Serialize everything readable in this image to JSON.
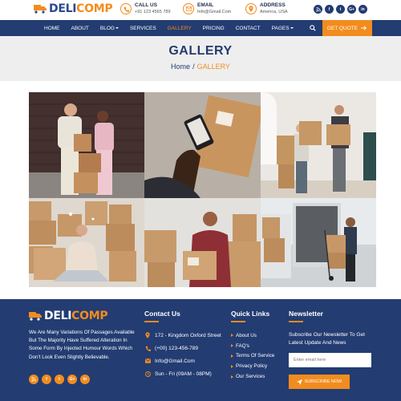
{
  "brand": {
    "part1": "DELI",
    "part2": "COMP"
  },
  "header": {
    "call": {
      "label": "CALL US",
      "value": "+91 123 4565 789"
    },
    "email": {
      "label": "EMAIL",
      "value": "Info@Gmail.Com"
    },
    "address": {
      "label": "ADDRESS",
      "value": "America, USA"
    },
    "socials": [
      "f",
      "t",
      "G+",
      "in"
    ]
  },
  "nav": {
    "items": [
      {
        "label": "HOME"
      },
      {
        "label": "ABOUT"
      },
      {
        "label": "BLOG"
      },
      {
        "label": "SERVICES"
      },
      {
        "label": "GALLERY"
      },
      {
        "label": "PRICING"
      },
      {
        "label": "CONTACT"
      },
      {
        "label": "PAGES"
      }
    ],
    "quote_label": "GET QUOTE"
  },
  "page": {
    "title": "GALLERY",
    "breadcrumb": {
      "home": "Home",
      "sep": "/",
      "current": "GALLERY"
    }
  },
  "footer": {
    "about": "We Are Many Variations Of Passages Available But The Majority Have Suffered Alteration In Some Form By Injected Humour Words Which Don't Look Even Slightly Believable.",
    "socials": [
      "f",
      "t",
      "G+",
      "in"
    ],
    "contact": {
      "title": "Contact Us",
      "address": "172 - Kingdom Oxford Street",
      "phone": "(+00) 123-456-789",
      "email": "Info@Gmail.Com",
      "hours": "Sun - Fri (09AM - 08PM)"
    },
    "links": {
      "title": "Quick Links",
      "items": [
        "About Us",
        "FAQ's",
        "Terms Of Service",
        "Privacy Policy",
        "Our Services"
      ]
    },
    "newsletter": {
      "title": "Newsletter",
      "text": "Subscribe Our Newsletter To Get Latest Update And News",
      "placeholder": "Enter email here",
      "button": "SUBSCRIBE NOW"
    }
  },
  "colors": {
    "primary": "#233c72",
    "accent": "#f28c1e",
    "band": "#eeeeee"
  }
}
